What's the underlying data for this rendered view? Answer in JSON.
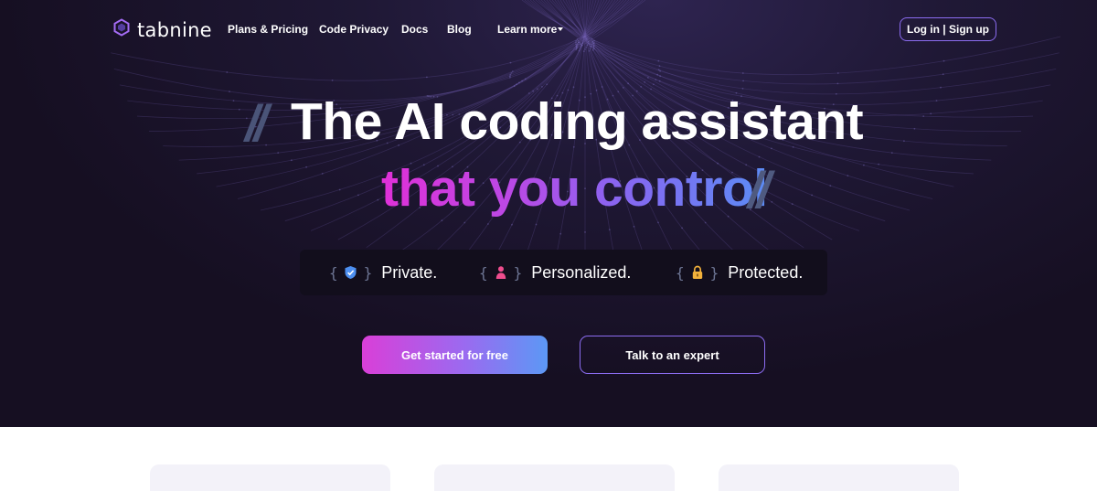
{
  "brand": {
    "name": "tabnine",
    "logo_icon": "hexagon-logo-icon"
  },
  "nav": {
    "links": [
      "Plans & Pricing",
      "Code Privacy",
      "Docs",
      "Blog",
      "Learn more"
    ],
    "learn_more_icon": "caret-down-icon",
    "auth_label": "Log in | Sign up"
  },
  "hero": {
    "decor_slashes": "//",
    "headline_line1": "The AI coding assistant",
    "headline_line2": "that you control",
    "features": [
      {
        "label": "Private.",
        "icon": "shield-check-icon"
      },
      {
        "label": "Personalized.",
        "icon": "person-icon"
      },
      {
        "label": "Protected.",
        "icon": "padlock-icon"
      }
    ],
    "brace_open": "{",
    "brace_close": "}",
    "cta_primary": "Get started for free",
    "cta_secondary": "Talk to an expert"
  },
  "colors": {
    "hero_bg": "#1b1430",
    "accent_purple": "#8b6cf0",
    "gradient_pink": "#e030d8",
    "gradient_blue": "#5b8cf5",
    "card_bg": "#f3f2f9"
  }
}
